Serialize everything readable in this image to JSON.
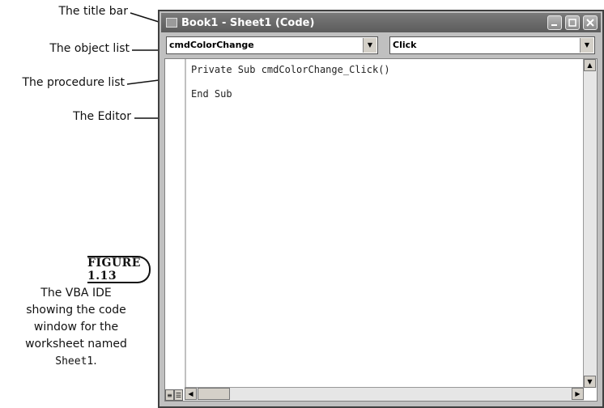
{
  "callouts": {
    "title_bar": "The title bar",
    "object_list": "The object list",
    "procedure_list": "The procedure list",
    "editor": "The Editor"
  },
  "figure": {
    "badge": "FIGURE 1.13",
    "caption_lines": [
      "The VBA IDE",
      "showing the code",
      "window for the",
      "worksheet named"
    ],
    "caption_code": "Sheet1",
    "caption_end": "."
  },
  "window": {
    "title": "Book1 - Sheet1 (Code)",
    "object_list_value": "cmdColorChange",
    "procedure_list_value": "Click",
    "code_lines": [
      "Private Sub cmdColorChange_Click()",
      "",
      "End Sub"
    ]
  },
  "icons": {
    "minimize": "minimize-icon",
    "maximize": "maximize-icon",
    "close": "close-icon",
    "dropdown": "chevron-down-icon"
  }
}
